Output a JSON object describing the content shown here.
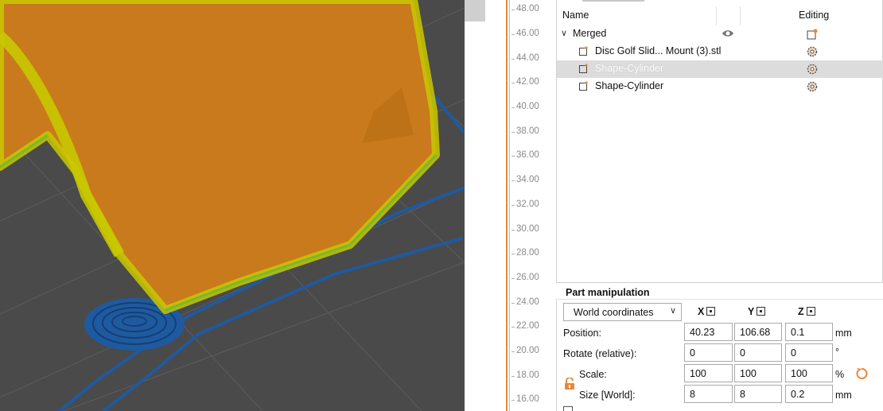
{
  "layer_ruler": {
    "ticks": [
      "48.00",
      "46.00",
      "44.00",
      "42.00",
      "40.00",
      "38.00",
      "36.00",
      "34.00",
      "32.00",
      "30.00",
      "28.00",
      "26.00",
      "24.00",
      "22.00",
      "20.00",
      "18.00",
      "16.00"
    ]
  },
  "object_list": {
    "header": {
      "name": "Name",
      "editing": "Editing"
    },
    "items": [
      {
        "label": "Merged",
        "expanded": true,
        "icon": "chevron-down-icon"
      },
      {
        "label": "Disc Golf Slid... Mount (3).stl",
        "icon": "part-icon"
      },
      {
        "label": "Shape-Cylinder",
        "icon": "part-icon",
        "selected": true
      },
      {
        "label": "Shape-Cylinder",
        "icon": "part-icon"
      }
    ]
  },
  "part_manipulation": {
    "title": "Part manipulation",
    "coordinate_system": "World coordinates",
    "axes": [
      "X",
      "Y",
      "Z"
    ],
    "rows": [
      {
        "label": "Position:",
        "values": [
          "40.23",
          "106.68",
          "0.1"
        ],
        "unit": "mm"
      },
      {
        "label": "Rotate (relative):",
        "values": [
          "0",
          "0",
          "0"
        ],
        "unit": "°"
      },
      {
        "label": "Scale:",
        "values": [
          "100",
          "100",
          "100"
        ],
        "unit": "%"
      },
      {
        "label": "Size [World]:",
        "values": [
          "8",
          "8",
          "0.2"
        ],
        "unit": "mm"
      }
    ]
  },
  "colors": {
    "accent": "#e7883d",
    "viewport_bg": "#4a4a4a",
    "model_fill": "#c87a1c",
    "model_edge": "#c8c800",
    "travel_blue": "#1e5aa0"
  }
}
